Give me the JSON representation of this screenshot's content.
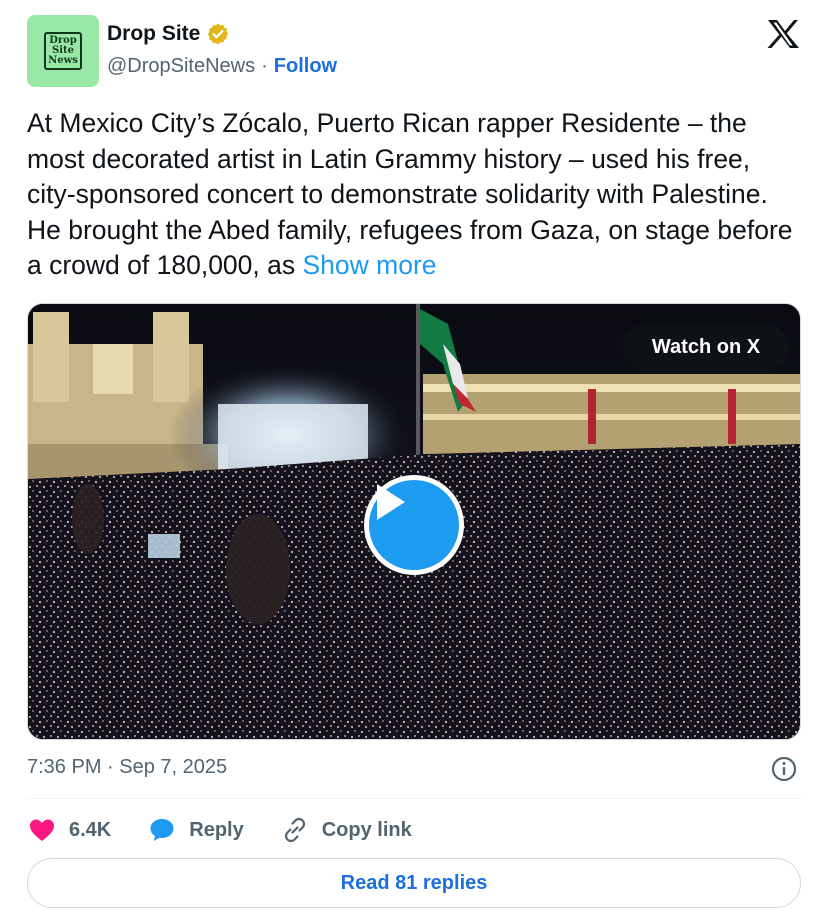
{
  "author": {
    "avatar_text": [
      "Drop",
      "Site",
      "News"
    ],
    "display_name": "Drop Site",
    "handle": "@DropSiteNews",
    "separator": "·",
    "follow_label": "Follow",
    "verified_color": "#e2b719"
  },
  "tweet": {
    "text": "At Mexico City’s Zócalo, Puerto Rican rapper Residente – the most decorated artist in Latin Grammy history – used his free, city-sponsored concert to demonstrate solidarity with Palestine. He brought the Abed family, refugees from Gaza, on stage before a crowd of 180,000, as",
    "show_more_label": "Show more"
  },
  "media": {
    "watch_label": "Watch on X",
    "play_icon": "play-icon"
  },
  "timestamp": "7:36 PM · Sep 7, 2025",
  "actions": {
    "likes_count": "6.4K",
    "reply_label": "Reply",
    "copy_link_label": "Copy link"
  },
  "read_replies_label": "Read 81 replies",
  "colors": {
    "accent": "#1d9bf0",
    "link": "#1d6ee0",
    "like": "#f91880",
    "muted": "#536471"
  }
}
